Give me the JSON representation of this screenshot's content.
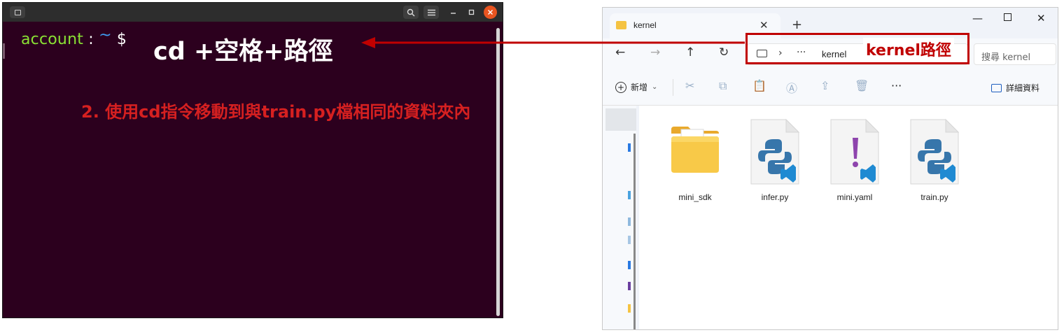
{
  "terminal": {
    "prompt_user": "account",
    "prompt_colon": ":",
    "prompt_tilde": "~",
    "prompt_dollar": "$",
    "command_hint": "cd +空格+路徑",
    "step_note": "2. 使用cd指令移動到與train.py檔相同的資料夾內",
    "close_color": "#e95420",
    "background_color": "#2c001e"
  },
  "explorer": {
    "tab_label": "kernel",
    "tab_close": "✕",
    "new_tab": "+",
    "window_controls": {
      "minimize": "—",
      "close": "✕"
    },
    "nav": {
      "back": "←",
      "forward": "→",
      "up": "↑",
      "refresh": "↻"
    },
    "address": {
      "separator": "›",
      "dots": "···",
      "current": "kernel"
    },
    "search_placeholder": "搜尋 kernel",
    "annotation": "kernel路徑",
    "toolbar": {
      "new_label": "新增",
      "new_chevron": "⌄",
      "more": "···",
      "details_label": "詳細資料"
    },
    "files": [
      {
        "name": "mini_sdk",
        "type": "folder-icon"
      },
      {
        "name": "infer.py",
        "type": "python-file-icon"
      },
      {
        "name": "mini.yaml",
        "type": "yaml-file-icon"
      },
      {
        "name": "train.py",
        "type": "python-file-icon"
      }
    ],
    "annotation_color": "#c00000"
  }
}
